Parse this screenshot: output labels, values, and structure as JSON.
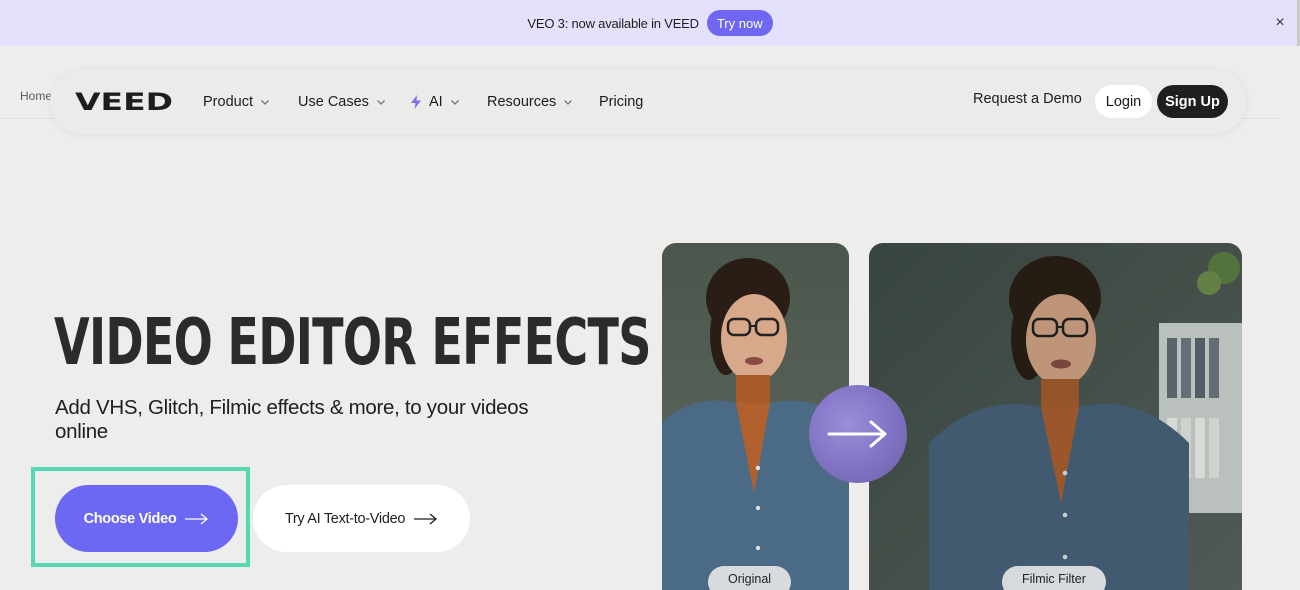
{
  "banner": {
    "text": "VEO 3: now available in VEED",
    "cta_label": "Try now",
    "close_glyph": "×"
  },
  "breadcrumb": {
    "home_label": "Home"
  },
  "nav": {
    "logo_text": "VEED",
    "items": [
      {
        "label": "Product",
        "icon": "chevron-down-icon"
      },
      {
        "label": "Use Cases",
        "icon": "chevron-down-icon"
      },
      {
        "label": "AI",
        "icon": "chevron-down-icon",
        "prefix_icon": "lightning-icon"
      },
      {
        "label": "Resources",
        "icon": "chevron-down-icon"
      },
      {
        "label": "Pricing"
      }
    ],
    "request_demo_label": "Request a Demo",
    "login_label": "Login",
    "signup_label": "Sign Up"
  },
  "hero": {
    "title": "VIDEO EDITOR EFFECTS",
    "subtitle": "Add VHS, Glitch, Filmic effects & more, to your videos online",
    "primary_cta": "Choose Video",
    "secondary_cta": "Try AI Text-to-Video"
  },
  "comparison": {
    "left_label": "Original",
    "right_label": "Filmic Filter",
    "arrow_icon": "arrow-right-icon"
  },
  "colors": {
    "accent": "#6c68f2",
    "banner_bg": "#e3e1fb",
    "highlight": "#55d8b4",
    "page_bg": "#ededec",
    "dark": "#1f1f1f"
  }
}
